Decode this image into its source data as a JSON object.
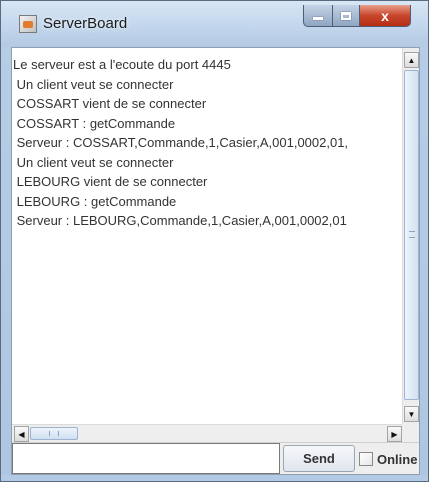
{
  "window": {
    "title": "ServerBoard",
    "close_label": "x"
  },
  "console": {
    "lines": [
      "Le serveur est a l'ecoute du port 4445",
      " Un client veut se connecter",
      " COSSART vient de se connecter",
      " COSSART : getCommande",
      " Serveur : COSSART,Commande,1,Casier,A,001,0002,01,",
      " Un client veut se connecter",
      " LEBOURG vient de se connecter",
      " LEBOURG : getCommande",
      " Serveur : LEBOURG,Commande,1,Casier,A,001,0002,01"
    ]
  },
  "scrollbars": {
    "up_arrow": "▲",
    "down_arrow": "▼",
    "left_arrow": "◀",
    "right_arrow": "▶"
  },
  "footer": {
    "message_value": "",
    "send_label": "Send",
    "online_label": "Online",
    "online_checked": false
  },
  "colors": {
    "accent": "#aec6e2",
    "close_button": "#c8462c"
  }
}
